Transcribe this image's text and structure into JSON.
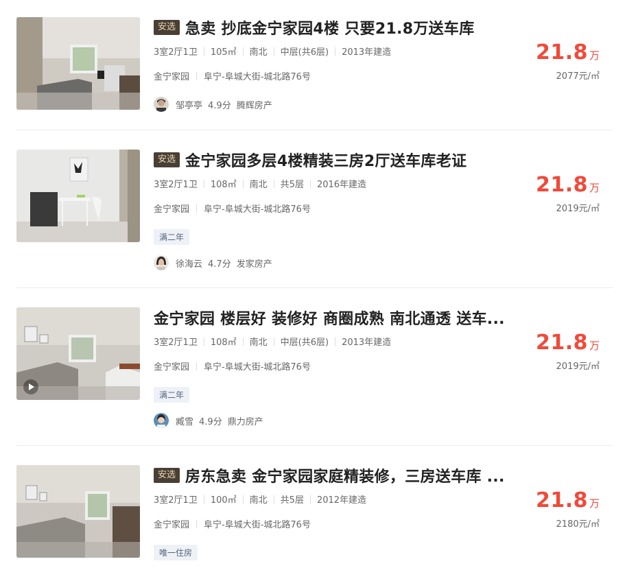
{
  "listings": [
    {
      "badge": "安选",
      "title": "急卖 抄底金宁家园4楼 只要21.8万送车库",
      "layout": "3室2厅1卫",
      "area": "105㎡",
      "orientation": "南北",
      "floor": "中层(共6层)",
      "built": "2013年建造",
      "community": "金宁家园",
      "address": "阜宁-阜城大街-城北路76号",
      "tag": "",
      "agent_name": "邹亭亭",
      "agent_score": "4.9分",
      "agent_company": "腾辉房产",
      "price_total": "21.8",
      "price_unit": "万",
      "price_per": "2077元/㎡"
    },
    {
      "badge": "安选",
      "title": "金宁家园多层4楼精装三房2厅送车库老证",
      "layout": "3室2厅1卫",
      "area": "108㎡",
      "orientation": "南北",
      "floor": "共5层",
      "built": "2016年建造",
      "community": "金宁家园",
      "address": "阜宁-阜城大街-城北路76号",
      "tag": "满二年",
      "agent_name": "徐海云",
      "agent_score": "4.7分",
      "agent_company": "发家房产",
      "price_total": "21.8",
      "price_unit": "万",
      "price_per": "2019元/㎡"
    },
    {
      "badge": "",
      "title": "金宁家园 楼层好 装修好 商圈成熟 南北通透 送车...",
      "layout": "3室2厅1卫",
      "area": "108㎡",
      "orientation": "南北",
      "floor": "中层(共6层)",
      "built": "2013年建造",
      "community": "金宁家园",
      "address": "阜宁-阜城大街-城北路76号",
      "tag": "满二年",
      "agent_name": "臧雪",
      "agent_score": "4.9分",
      "agent_company": "鼎力房产",
      "price_total": "21.8",
      "price_unit": "万",
      "price_per": "2019元/㎡"
    },
    {
      "badge": "安选",
      "title": "房东急卖 金宁家园家庭精装修，三房送车库 ...",
      "layout": "3室2厅1卫",
      "area": "100㎡",
      "orientation": "南北",
      "floor": "共5层",
      "built": "2012年建造",
      "community": "金宁家园",
      "address": "阜宁-阜城大街-城北路76号",
      "tag": "唯一住房",
      "agent_name": "",
      "agent_score": "",
      "agent_company": "",
      "price_total": "21.8",
      "price_unit": "万",
      "price_per": "2180元/㎡"
    }
  ],
  "colors": {
    "price": "#f04a3a",
    "badge_bg": "#4a3f33",
    "badge_text": "#e8d7b9",
    "tag_bg": "#eef2f7",
    "tag_text": "#56657d"
  }
}
